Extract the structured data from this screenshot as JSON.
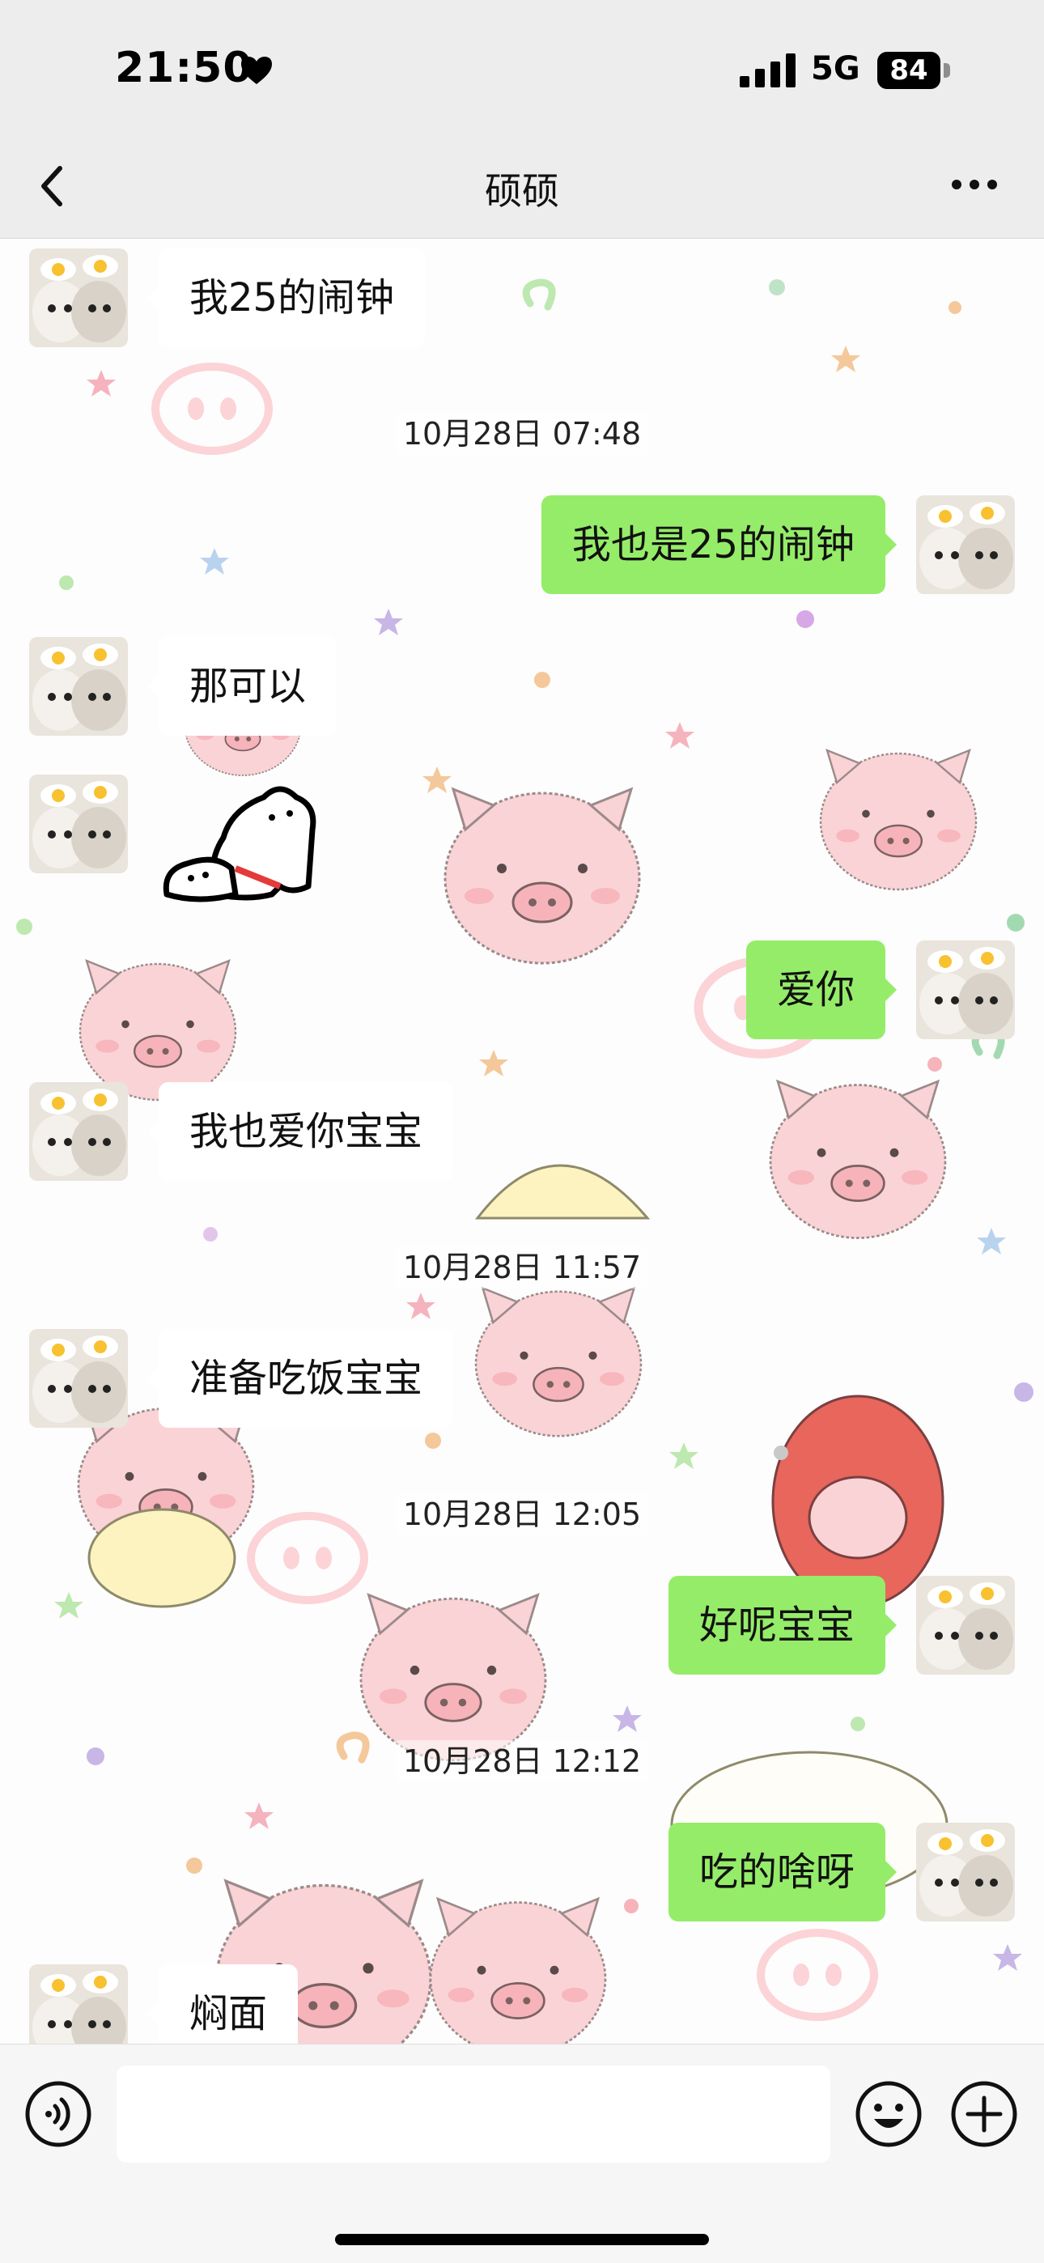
{
  "status_bar": {
    "time": "21:50",
    "network": "5G",
    "battery_level": "84"
  },
  "header": {
    "title": "硕硕"
  },
  "icons": {
    "back": "chevron-left-icon",
    "more": "more-dots-icon",
    "voice": "voice-icon",
    "emoji": "emoji-icon",
    "plus": "plus-icon",
    "heart": "heart-icon",
    "signal": "signal-icon",
    "battery": "battery-icon"
  },
  "colors": {
    "outgoing_bubble": "#95ec69",
    "incoming_bubble": "#ffffff",
    "pig_pink": "#f9cfd2"
  },
  "messages": [
    {
      "side": "in",
      "text": "我25的闹钟"
    },
    {
      "side": "out",
      "text": "我也是25的闹钟"
    },
    {
      "side": "in",
      "text": "那可以"
    },
    {
      "side": "in",
      "type": "sticker"
    },
    {
      "side": "out",
      "text": "爱你"
    },
    {
      "side": "in",
      "text": "我也爱你宝宝"
    },
    {
      "side": "in",
      "text": "准备吃饭宝宝"
    },
    {
      "side": "out",
      "text": "好呢宝宝"
    },
    {
      "side": "out",
      "text": "吃的啥呀"
    },
    {
      "side": "in",
      "text": "焖面"
    }
  ],
  "timestamps": [
    "10月28日 07:48",
    "10月28日 11:57",
    "10月28日 12:05",
    "10月28日 12:12"
  ],
  "input": {
    "value": "",
    "placeholder": ""
  }
}
